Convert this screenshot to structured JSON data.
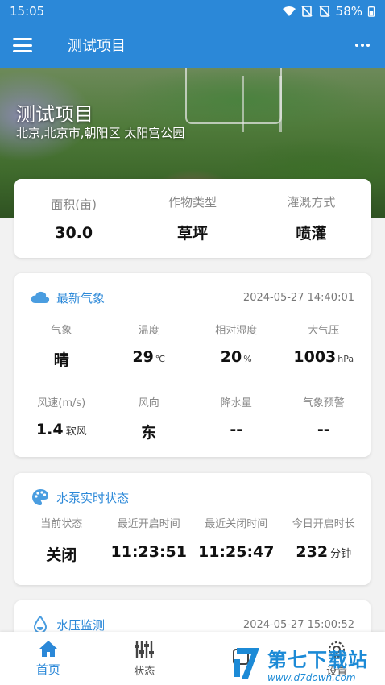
{
  "status_bar": {
    "time": "15:05",
    "battery": "58%"
  },
  "app_bar": {
    "title": "测试项目"
  },
  "hero": {
    "title": "测试项目",
    "address": "北京,北京市,朝阳区 太阳宫公园"
  },
  "summary": [
    {
      "label": "面积(亩)",
      "value": "30.0"
    },
    {
      "label": "作物类型",
      "value": "草坪"
    },
    {
      "label": "灌溉方式",
      "value": "喷灌"
    }
  ],
  "weather": {
    "title": "最新气象",
    "time": "2024-05-27 14:40:01",
    "row1": [
      {
        "label": "气象",
        "value": "晴",
        "unit": ""
      },
      {
        "label": "温度",
        "value": "29",
        "unit": "℃"
      },
      {
        "label": "相对湿度",
        "value": "20",
        "unit": "%"
      },
      {
        "label": "大气压",
        "value": "1003",
        "unit": "hPa"
      }
    ],
    "row2": [
      {
        "label": "风速(m/s)",
        "value": "1.4",
        "unit": "软风"
      },
      {
        "label": "风向",
        "value": "东",
        "unit": ""
      },
      {
        "label": "降水量",
        "value": "--",
        "unit": ""
      },
      {
        "label": "气象预警",
        "value": "--",
        "unit": ""
      }
    ]
  },
  "pump": {
    "title": "水泵实时状态",
    "items": [
      {
        "label": "当前状态",
        "value": "关闭",
        "unit": ""
      },
      {
        "label": "最近开启时间",
        "value": "11:23:51",
        "unit": ""
      },
      {
        "label": "最近关闭时间",
        "value": "11:25:47",
        "unit": ""
      },
      {
        "label": "今日开启时长",
        "value": "232",
        "unit": "分钟"
      }
    ]
  },
  "pressure": {
    "title": "水压监测",
    "time": "2024-05-27 15:00:52"
  },
  "bottom_nav": [
    {
      "label": "首页",
      "icon": "home-icon",
      "active": true
    },
    {
      "label": "状态",
      "icon": "equalizer-icon",
      "active": false
    },
    {
      "label": "",
      "icon": "control-icon",
      "active": false
    },
    {
      "label": "设置",
      "icon": "settings-icon",
      "active": false
    }
  ],
  "watermark": {
    "name": "第七下载站",
    "url": "www.d7down.com"
  },
  "colors": {
    "primary": "#2b88d8",
    "text": "#111111",
    "muted": "#888888",
    "background": "#f2f2f2"
  }
}
